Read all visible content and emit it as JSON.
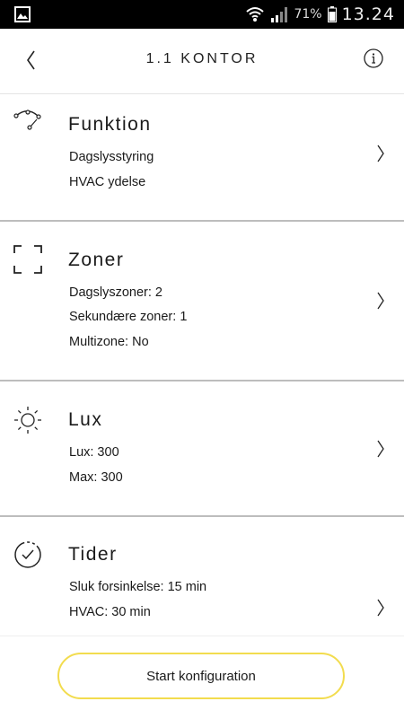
{
  "status_bar": {
    "battery_percent": "71%",
    "time": "13.24"
  },
  "header": {
    "title": "1.1 KONTOR",
    "back_icon": "chevron-left-icon",
    "info_icon": "info-icon"
  },
  "sections": [
    {
      "icon": "curve-nodes-icon",
      "title": "Funktion",
      "lines": [
        "Dagslysstyring",
        "HVAC ydelse"
      ]
    },
    {
      "icon": "zone-frame-icon",
      "title": "Zoner",
      "lines": [
        "Dagslyszoner: 2",
        "Sekundære zoner: 1",
        "Multizone: No"
      ]
    },
    {
      "icon": "sun-icon",
      "title": "Lux",
      "lines": [
        "Lux: 300",
        "Max: 300"
      ]
    },
    {
      "icon": "clock-check-icon",
      "title": "Tider",
      "lines": [
        "Sluk forsinkelse: 15 min",
        "HVAC: 30 min"
      ]
    }
  ],
  "actions": {
    "start_label": "Start konfiguration"
  },
  "colors": {
    "accent_yellow": "#f2dc4e",
    "divider": "#bdbdbd"
  }
}
